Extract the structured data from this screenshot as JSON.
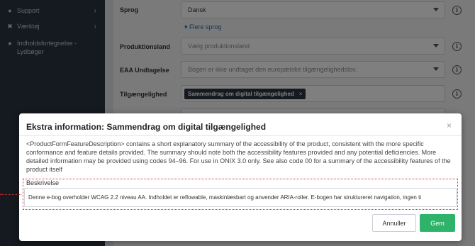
{
  "sidebar": {
    "items": [
      {
        "icon": "globe-icon",
        "glyph": "●",
        "label": "Support",
        "has_chevron": true
      },
      {
        "icon": "tools-icon",
        "glyph": "✖",
        "label": "Værktøj",
        "has_chevron": true
      },
      {
        "icon": "book-icon",
        "glyph": "●",
        "label": "Indholdsfortegnelse - Lydbøger",
        "has_chevron": false
      }
    ]
  },
  "form": {
    "language_label": "Sprog",
    "language_value": "Dansk",
    "more_languages_link": "▾ Flere sprog",
    "production_country_label": "Produktionsland",
    "production_country_placeholder": "Vælg produktionsland",
    "eaa_label": "EAA Undtagelse",
    "eaa_placeholder": "Bogen er ikke undtaget den europæiske tilgængelighedslov.",
    "accessibility_label": "Tilgængelighed",
    "accessibility_tag": "Sammendrag om digital tilgængelighed",
    "tag_remove": "×"
  },
  "modal": {
    "title": "Ekstra information: Sammendrag om digital tilgængelighed",
    "close": "×",
    "description": "<ProductFormFeatureDescription> contains a short explanatory summary of the accessibility of the product, consistent with the more specific conformance and feature details provided. The summary should note both the accessibility features provided and any potential deficiencies. More detailed information may be provided using codes 94–96. For use in ONIX 3.0 only. See also code 00 for a summary of the accessibility features of the product itself",
    "field_label": "Beskrivelse",
    "field_value": "Denne e-bog overholder WCAG 2.2 niveau AA. Indholdet er reflowable, maskinlæsbart og anvender ARIA-roller. E-bogen har struktureret navigation, ingen ti",
    "cancel_label": "Annuller",
    "save_label": "Gem"
  },
  "colors": {
    "sidebar_bg": "#2b3440",
    "primary_green": "#2fb36a",
    "link_blue": "#2e6bb6",
    "highlight_red": "#d33"
  }
}
